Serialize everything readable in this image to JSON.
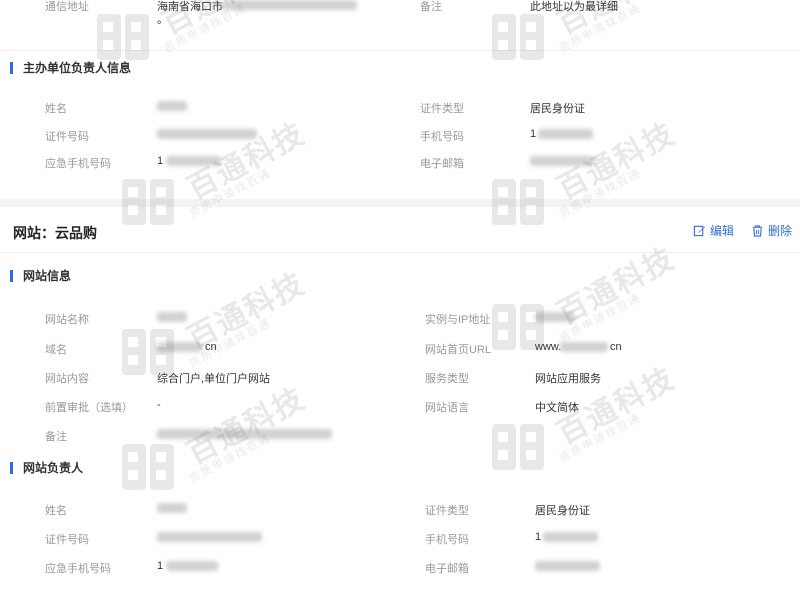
{
  "owner_info": {
    "address": {
      "label": "通信地址",
      "value": "海南省海口市",
      "value_line2": "。"
    },
    "remark": {
      "label": "备注",
      "value": "此地址以为最详细"
    },
    "section_title": "主办单位负责人信息",
    "name": {
      "label": "姓名"
    },
    "id_type": {
      "label": "证件类型",
      "value": "居民身份证"
    },
    "id_number": {
      "label": "证件号码"
    },
    "mobile": {
      "label": "手机号码",
      "value": "1"
    },
    "emergency_mobile": {
      "label": "应急手机号码",
      "value": "1"
    },
    "email": {
      "label": "电子邮箱"
    }
  },
  "website": {
    "title": "网站：云品购",
    "edit_label": "编辑",
    "delete_label": "删除",
    "info_section_title": "网站信息",
    "site_name": {
      "label": "网站名称"
    },
    "ip": {
      "label": "实例与IP地址"
    },
    "domain": {
      "label": "域名",
      "value": "cn"
    },
    "homepage_url": {
      "label": "网站首页URL",
      "value_prefix": "www.",
      "value_suffix": "cn"
    },
    "content": {
      "label": "网站内容",
      "value": "综合门户,单位门户网站"
    },
    "service_type": {
      "label": "服务类型",
      "value": "网站应用服务"
    },
    "pre_approval": {
      "label": "前置审批（选填）",
      "value": "-"
    },
    "language": {
      "label": "网站语言",
      "value": "中文简体"
    },
    "note": {
      "label": "备注"
    },
    "manager_section_title": "网站负责人",
    "mgr_name": {
      "label": "姓名"
    },
    "mgr_id_type": {
      "label": "证件类型",
      "value": "居民身份证"
    },
    "mgr_id_number": {
      "label": "证件号码"
    },
    "mgr_mobile": {
      "label": "手机号码",
      "value": "1"
    },
    "mgr_emergency_mobile": {
      "label": "应急手机号码",
      "value": "1"
    },
    "mgr_email": {
      "label": "电子邮箱"
    }
  },
  "watermark": {
    "text1": "百通科技",
    "text2": "资质申请找百通"
  },
  "colors": {
    "accent": "#2f6fd6",
    "label": "#999999",
    "value": "#333333",
    "background": "#f2f3f5"
  }
}
